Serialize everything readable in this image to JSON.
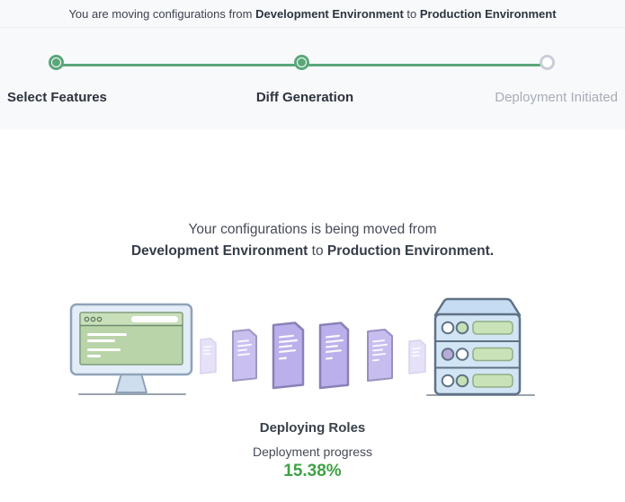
{
  "header": {
    "prefix": "You are moving configurations from",
    "source_env": "Development Environment",
    "connector": "to",
    "target_env": "Production Environment"
  },
  "stepper": {
    "steps": [
      {
        "label": "Select Features",
        "state": "complete"
      },
      {
        "label": "Diff Generation",
        "state": "active"
      },
      {
        "label": "Deployment Initiated",
        "state": "pending"
      }
    ]
  },
  "main": {
    "message_line1": "Your configurations is being moved from",
    "source_env": "Development Environment",
    "connector": "to",
    "target_env": "Production Environment.",
    "status_title": "Deploying Roles",
    "progress_label": "Deployment progress",
    "progress_value": "15.38%"
  },
  "icons": {
    "monitor": "monitor-browser-illustration",
    "documents": "moving-documents-illustration",
    "server": "server-rack-illustration"
  },
  "colors": {
    "step_green": "#5aa77a",
    "progress_green": "#3fa244",
    "pending_gray": "#a7acb6",
    "top_section_bg": "#f8f9fb",
    "document_purple": "#c1b6ee",
    "screen_green": "#b9d4a8",
    "device_blue": "#d2e5f5"
  }
}
